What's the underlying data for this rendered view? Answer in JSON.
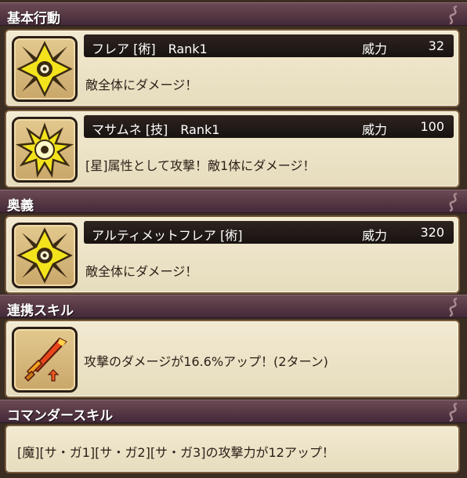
{
  "sections": {
    "basic": "基本行動",
    "ougi": "奥義",
    "renkei": "連携スキル",
    "commander": "コマンダースキル"
  },
  "power_label": "威力",
  "actions": [
    {
      "name": "フレア [術]　Rank1",
      "power": "32",
      "desc": "敵全体にダメージ！",
      "icon": "shuriken-icon"
    },
    {
      "name": "マサムネ [技]　Rank1",
      "power": "100",
      "desc": "[星]属性として攻撃！敵1体にダメージ！",
      "icon": "star-burst-icon"
    }
  ],
  "ultimate": {
    "name": "アルティメットフレア [術]",
    "power": "320",
    "desc": "敵全体にダメージ！",
    "icon": "shuriken-icon"
  },
  "renkei_skill": {
    "desc": "攻撃のダメージが16.6%アップ！(2ターン)",
    "icon": "flame-sword-icon"
  },
  "commander_skill": {
    "desc": "[魔][サ・ガ1][サ・ガ2][サ・ガ3]の攻撃力が12アップ！"
  },
  "colors": {
    "header": "#553843",
    "card": "#eee5cb",
    "title_bar": "#201815",
    "icon_yellow": "#f2e21c"
  }
}
